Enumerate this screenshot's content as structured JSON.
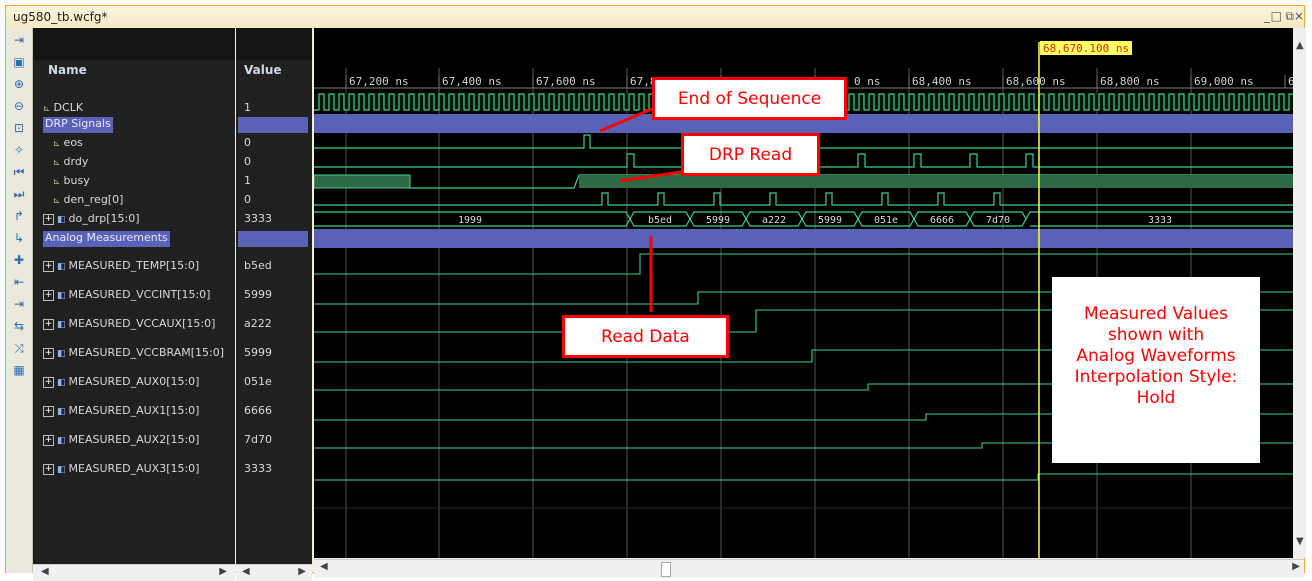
{
  "window": {
    "title": "ug580_tb.wcfg*"
  },
  "headers": {
    "name": "Name",
    "value": "Value"
  },
  "signals": [
    {
      "name": "DCLK",
      "value": "1",
      "kind": "bit"
    },
    {
      "name": "DRP Signals",
      "value": "",
      "kind": "group"
    },
    {
      "name": "eos",
      "value": "0",
      "kind": "bit"
    },
    {
      "name": "drdy",
      "value": "0",
      "kind": "bit"
    },
    {
      "name": "busy",
      "value": "1",
      "kind": "bit"
    },
    {
      "name": "den_reg[0]",
      "value": "0",
      "kind": "bit"
    },
    {
      "name": "do_drp[15:0]",
      "value": "3333",
      "kind": "bus"
    },
    {
      "name": "Analog Measurements",
      "value": "",
      "kind": "group"
    },
    {
      "name": "MEASURED_TEMP[15:0]",
      "value": "b5ed",
      "kind": "analog"
    },
    {
      "name": "MEASURED_VCCINT[15:0]",
      "value": "5999",
      "kind": "analog"
    },
    {
      "name": "MEASURED_VCCAUX[15:0]",
      "value": "a222",
      "kind": "analog"
    },
    {
      "name": "MEASURED_VCCBRAM[15:0]",
      "value": "5999",
      "kind": "analog"
    },
    {
      "name": "MEASURED_AUX0[15:0]",
      "value": "051e",
      "kind": "analog"
    },
    {
      "name": "MEASURED_AUX1[15:0]",
      "value": "6666",
      "kind": "analog"
    },
    {
      "name": "MEASURED_AUX2[15:0]",
      "value": "7d70",
      "kind": "analog"
    },
    {
      "name": "MEASURED_AUX3[15:0]",
      "value": "3333",
      "kind": "analog"
    }
  ],
  "timeline": {
    "ticks": [
      "67,200 ns",
      "67,400 ns",
      "67,600 ns",
      "67,8",
      "0 ns",
      "68,400 ns",
      "68,600 ns",
      "68,800 ns",
      "69,000 ns",
      "6"
    ],
    "cursor_label": "68,670.100 ns"
  },
  "do_drp_values": [
    "1999",
    "b5ed",
    "5999",
    "a222",
    "5999",
    "051e",
    "6666",
    "7d70",
    "3333"
  ],
  "callouts": {
    "end_of_sequence": "End of Sequence",
    "drp_read": "DRP Read",
    "read_data": "Read Data",
    "measured_lines": [
      "Measured Values",
      "shown with",
      "Analog Waveforms",
      "Interpolation Style:",
      "Hold"
    ]
  },
  "colors": {
    "group": "#5a62b8",
    "wave": "#3fcf8e",
    "cursor": "#ffff33",
    "callout": "#ff0000"
  }
}
